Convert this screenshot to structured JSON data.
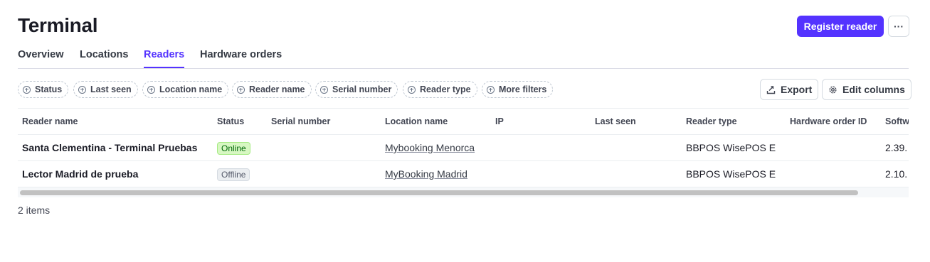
{
  "header": {
    "title": "Terminal",
    "register_label": "Register reader",
    "more_label": "···"
  },
  "tabs": [
    {
      "label": "Overview"
    },
    {
      "label": "Locations"
    },
    {
      "label": "Readers",
      "active": true
    },
    {
      "label": "Hardware orders"
    }
  ],
  "filters": [
    {
      "label": "Status"
    },
    {
      "label": "Last seen"
    },
    {
      "label": "Location name"
    },
    {
      "label": "Reader name"
    },
    {
      "label": "Serial number"
    },
    {
      "label": "Reader type"
    },
    {
      "label": "More filters"
    }
  ],
  "actions": {
    "export_label": "Export",
    "edit_columns_label": "Edit columns"
  },
  "table": {
    "columns": [
      "Reader name",
      "Status",
      "Serial number",
      "Location name",
      "IP",
      "Last seen",
      "Reader type",
      "Hardware order ID",
      "Softw"
    ],
    "rows": [
      {
        "reader_name": "Santa Clementina - Terminal Pruebas",
        "status": "Online",
        "serial": "",
        "location": "Mybooking Menorca",
        "ip": "",
        "last_seen": "",
        "reader_type": "BBPOS WisePOS E",
        "hardware_order": "",
        "software": "2.39."
      },
      {
        "reader_name": "Lector Madrid de prueba",
        "status": "Offline",
        "serial": "",
        "location": "MyBooking Madrid",
        "ip": "",
        "last_seen": "",
        "reader_type": "BBPOS WisePOS E",
        "hardware_order": "",
        "software": "2.10."
      }
    ]
  },
  "footer": {
    "count_label": "2 items"
  },
  "colors": {
    "accent": "#5433ff",
    "online_bg": "#d7f7c2",
    "online_text": "#006908",
    "offline_bg": "#ebeef1"
  }
}
